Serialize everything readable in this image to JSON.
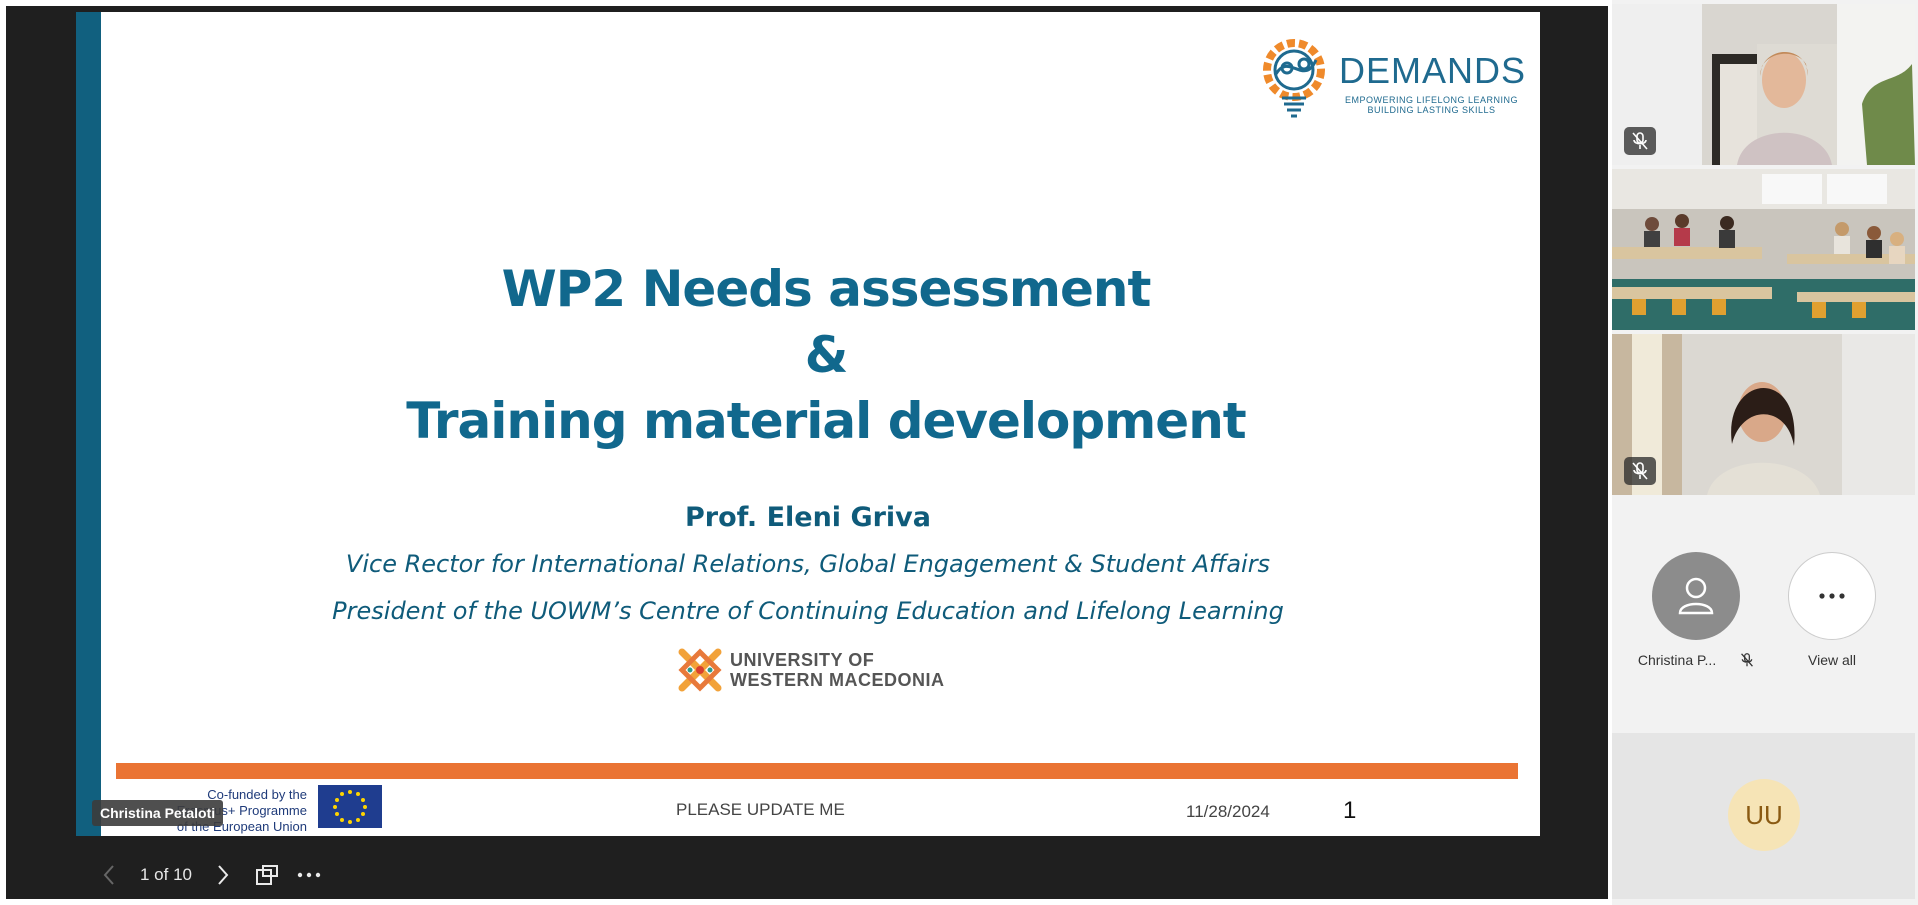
{
  "slide": {
    "logo": {
      "name": "DEMANDS",
      "tagline_1": "EMPOWERING LIFELONG LEARNING",
      "tagline_2": "BUILDING LASTING SKILLS"
    },
    "title_line_1": "WP2 Needs assessment",
    "title_line_2": "&",
    "title_line_3": "Training material development",
    "presenter": "Prof. Eleni Griva",
    "role": "Vice Rector for International Relations, Global Engagement & Student Affairs",
    "organization": "President of the UOWM’s Centre of Continuing Education and Lifelong Learning",
    "university_logo_line_1": "UNIVERSITY OF",
    "university_logo_line_2": "WESTERN MACEDONIA",
    "footer": {
      "cofunded_1": "Co-funded by the",
      "cofunded_2": "Erasmus+ Programme",
      "cofunded_3": "of the European Union",
      "center_text": "PLEASE UPDATE ME",
      "date": "11/28/2024",
      "page_number": "1"
    }
  },
  "speaker_tag": "Christina Petaloti",
  "controls": {
    "page_indicator": "1 of 10",
    "prev_icon": "chevron-left-icon",
    "next_icon": "chevron-right-icon",
    "layout_icon": "slide-layout-icon",
    "more_icon": "more-icon"
  },
  "participants": {
    "christina_label": "Christina P...",
    "view_all_label": "View all",
    "uu_initials": "UU"
  },
  "colors": {
    "title_blue": "#11688d",
    "sidebar_blue": "#11607f",
    "footer_orange": "#ea7434",
    "stage_bg": "#1f1f1f"
  }
}
